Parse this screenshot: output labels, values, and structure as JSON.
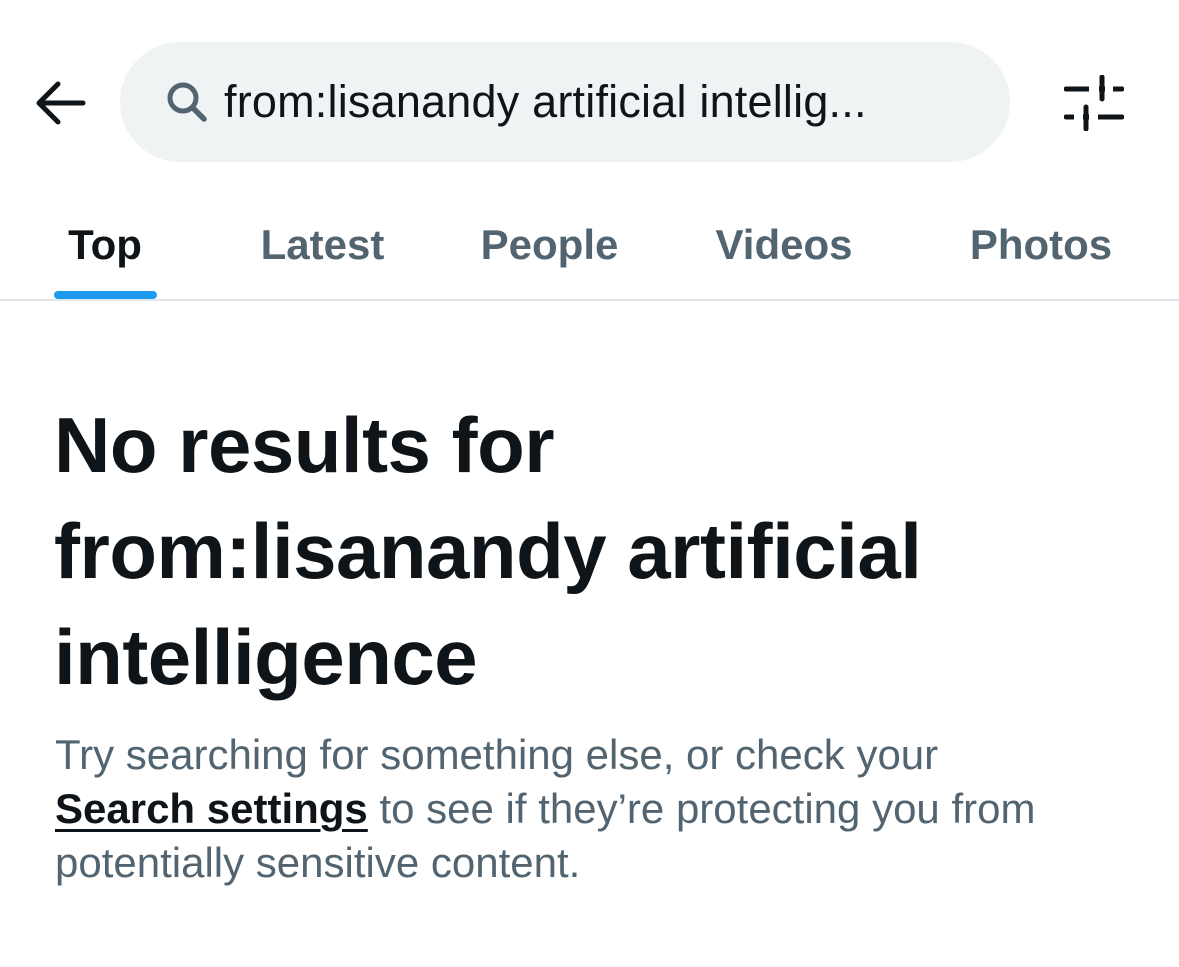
{
  "search": {
    "query": "from:lisanandy artificial intellig..."
  },
  "tabs": [
    {
      "label": "Top",
      "active": true
    },
    {
      "label": "Latest",
      "active": false
    },
    {
      "label": "People",
      "active": false
    },
    {
      "label": "Videos",
      "active": false
    },
    {
      "label": "Photos",
      "active": false
    }
  ],
  "empty_state": {
    "title_line1": "No results for",
    "title_line2": "from:lisanandy artificial",
    "title_line3": "intelligence",
    "message_before": "Try searching for something else, or check your ",
    "link_label": "Search settings",
    "message_after": " to see if they’re protecting you from potentially sensitive content."
  },
  "icons": {
    "back": "arrow-left-icon",
    "search": "search-icon",
    "filter": "sliders-icon"
  },
  "colors": {
    "accent": "#1d9bf0",
    "text_primary": "#0f1419",
    "text_secondary": "#536471",
    "search_bg": "#eff3f4"
  }
}
